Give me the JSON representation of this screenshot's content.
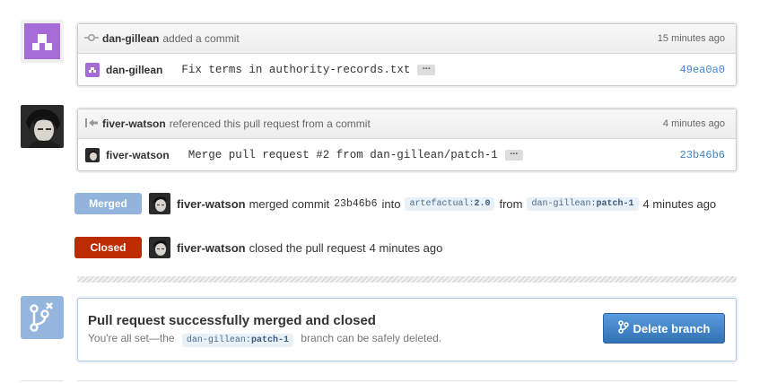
{
  "events": [
    {
      "actor": "dan-gillean",
      "action": "added a commit",
      "time": "15 minutes ago",
      "commit_author": "dan-gillean",
      "commit_message": "Fix terms in authority-records.txt",
      "ellipsis": "…",
      "sha": "49ea0a0"
    },
    {
      "actor": "fiver-watson",
      "action": "referenced this pull request from a commit",
      "time": "4 minutes ago",
      "commit_author": "fiver-watson",
      "commit_message": "Merge pull request #2 from dan-gillean/patch-1",
      "ellipsis": "…",
      "sha": "23b46b6"
    }
  ],
  "merged_event": {
    "badge": "Merged",
    "badge_color": "#91b3dc",
    "actor": "fiver-watson",
    "text1": "merged commit",
    "sha": "23b46b6",
    "text2": "into",
    "base_repo": "artefactual:",
    "base_branch": "2.0",
    "text3": "from",
    "head_repo": "dan-gillean:",
    "head_branch": "patch-1",
    "time": "4 minutes ago"
  },
  "closed_event": {
    "badge": "Closed",
    "badge_color": "#bd2c00",
    "actor": "fiver-watson",
    "text": "closed the pull request",
    "time": "4 minutes ago"
  },
  "merge_box": {
    "title": "Pull request successfully merged and closed",
    "sub_before": "You're all set—the",
    "branch_repo": "dan-gillean:",
    "branch_name": "patch-1",
    "sub_after": "branch can be safely deleted.",
    "delete_button": "Delete branch"
  },
  "icons": {
    "commit": "git-commit-icon",
    "reference": "reference-arrow-icon",
    "merge": "git-merge-icon",
    "branch": "git-branch-icon"
  }
}
